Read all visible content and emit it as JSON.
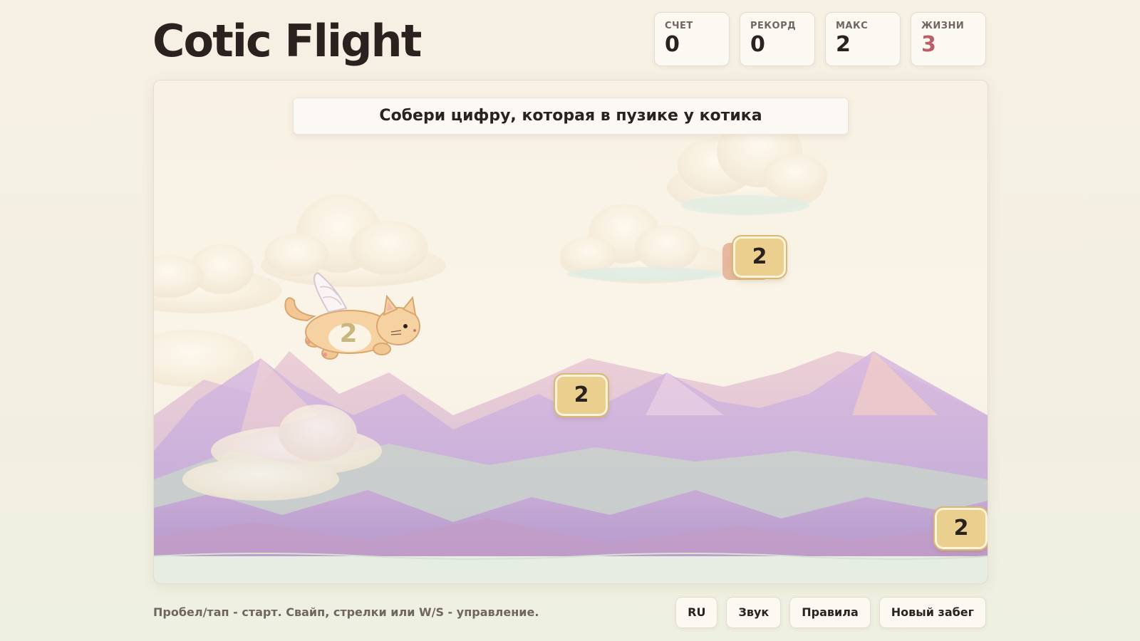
{
  "header": {
    "title": "Cotic Flight"
  },
  "stats": [
    {
      "label": "СЧЕТ",
      "value": "0"
    },
    {
      "label": "РЕКОРД",
      "value": "0"
    },
    {
      "label": "МАКС",
      "value": "2"
    },
    {
      "label": "ЖИЗНИ",
      "value": "3"
    }
  ],
  "game": {
    "hint": "Собери цифру, которая в пузике у котика",
    "cat_number": "2",
    "tokens": [
      "2",
      "2",
      "2"
    ]
  },
  "footer": {
    "hint": "Пробел/тап - старт. Свайп, стрелки или W/S - управление.",
    "buttons": {
      "language": "RU",
      "sound": "Звук",
      "rules": "Правила",
      "new_run": "Новый забег"
    }
  },
  "colors": {
    "accent": "#ebcf8e",
    "lives": "#b8606a",
    "text": "#2a2220"
  }
}
